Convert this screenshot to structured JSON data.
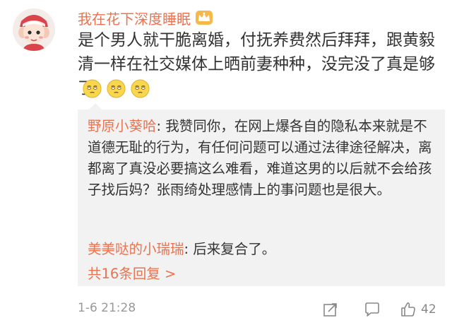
{
  "comment": {
    "username": "我在花下深度睡眠",
    "badge_icon": "crown-icon",
    "text": "是个男人就干脆离婚，付抚养费然后拜拜，跟黄毅清一样在社交媒体上晒前妻种种，没完没了真是够了",
    "emojis": [
      "dizzy-face-emoji",
      "dizzy-face-emoji",
      "dizzy-face-emoji"
    ],
    "timestamp": "1-6 21:28",
    "like_count": "42"
  },
  "replies": [
    {
      "author": "野原小葵哈",
      "text": "我赞同你，在网上爆各自的隐私本来就是不道德无耻的行为，有任何问题可以通过法律途径解决，离都离了真没必要搞这么难看，难道这男的以后就不会给孩子找后妈？张雨绮处理感情上的事问题也是很大。"
    },
    {
      "author": "美美哒的小瑞瑞",
      "text": "后来复合了。"
    }
  ],
  "reply_separator": ": ",
  "more_replies_label": "共16条回复 >",
  "colors": {
    "accent": "#eb7350",
    "text": "#333333",
    "muted": "#999999",
    "reply_bg": "#f2f2f2"
  },
  "icons": [
    "avatar",
    "crown-icon",
    "dizzy-face-emoji",
    "share-icon",
    "comment-icon",
    "like-icon"
  ]
}
